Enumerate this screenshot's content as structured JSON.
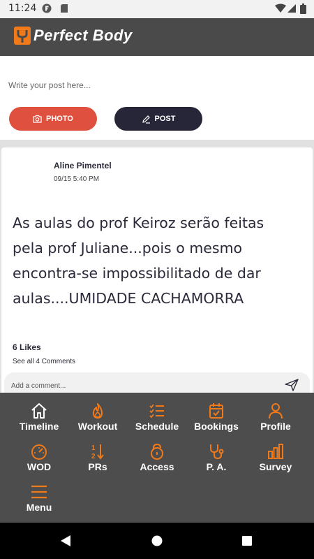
{
  "status_bar": {
    "time": "11:24"
  },
  "app": {
    "title": "Perfect Body"
  },
  "composer": {
    "placeholder": "Write your post here...",
    "photo_label": "PHOTO",
    "post_label": "POST"
  },
  "feed": {
    "post": {
      "author": "Aline Pimentel",
      "date": "09/15 5:40 PM",
      "text": "As aulas do prof Keiroz serão feitas pela prof Juliane...pois o mesmo encontra-se impossibilitado de dar aulas....UMIDADE CACHAMORRA",
      "likes": "6 Likes",
      "comments_link": "See all 4 Comments",
      "comment_placeholder": "Add a comment..."
    }
  },
  "bottom_nav": {
    "items": [
      {
        "label": "Timeline",
        "icon": "home-icon"
      },
      {
        "label": "Workout",
        "icon": "flame-icon"
      },
      {
        "label": "Schedule",
        "icon": "checklist-icon"
      },
      {
        "label": "Bookings",
        "icon": "calendar-check-icon"
      },
      {
        "label": "Profile",
        "icon": "person-icon"
      },
      {
        "label": "WOD",
        "icon": "gauge-icon"
      },
      {
        "label": "PRs",
        "icon": "sort-numeric-icon"
      },
      {
        "label": "Access",
        "icon": "lock-icon"
      },
      {
        "label": "P. A.",
        "icon": "stethoscope-icon"
      },
      {
        "label": "Survey",
        "icon": "bar-chart-icon"
      },
      {
        "label": "Menu",
        "icon": "hamburger-icon"
      }
    ]
  },
  "colors": {
    "accent": "#f07a1a",
    "header_bg": "#4a4a4a",
    "photo_button": "#e0503f",
    "post_button": "#262638",
    "nav_bg": "#4d4d4d"
  }
}
